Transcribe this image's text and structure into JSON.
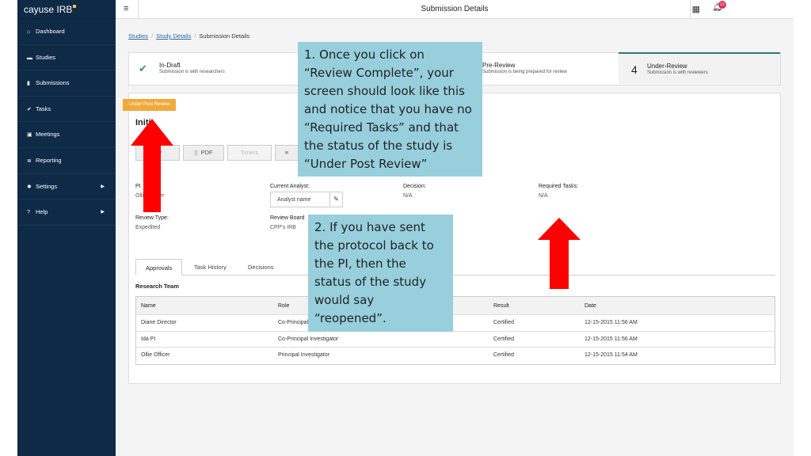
{
  "brand": {
    "name": "cayuse IRB",
    "accent": "#f0c040"
  },
  "sidebar": {
    "items": [
      {
        "label": "Dashboard",
        "icon": "home-icon"
      },
      {
        "label": "Studies",
        "icon": "folder-icon"
      },
      {
        "label": "Submissions",
        "icon": "document-icon"
      },
      {
        "label": "Tasks",
        "icon": "check-icon"
      },
      {
        "label": "Meetings",
        "icon": "calendar-icon"
      },
      {
        "label": "Reporting",
        "icon": "list-icon"
      },
      {
        "label": "Settings",
        "icon": "gear-icon"
      },
      {
        "label": "Help",
        "icon": "question-icon"
      }
    ]
  },
  "topbar": {
    "title": "Submission Details",
    "notification_count": "13"
  },
  "breadcrumb": {
    "items": [
      "Studies",
      "Study Details",
      "Submission Details"
    ]
  },
  "steps": {
    "step1": {
      "title": "In-Draft",
      "subtitle": "Submission is with researchers"
    },
    "step3": {
      "title": "Pre-Review",
      "subtitle": "Submission is being prepared for review"
    },
    "step4": {
      "number": "4",
      "title": "Under-Review",
      "subtitle": "Submission is with reviewers"
    }
  },
  "panel": {
    "status_ribbon": "Under Post Review",
    "submission_name": "Initi",
    "buttons": {
      "review": "ew",
      "pdf": "PDF",
      "timer": "Timers"
    },
    "fields": {
      "pi_label": "PI",
      "pi_value": "Ollie Officer",
      "analyst_label": "Current Analyst:",
      "analyst_value": "Analyst name",
      "decision_label": "Decision:",
      "decision_value": "N/A",
      "required_label": "Required Tasks:",
      "required_value": "N/A",
      "review_type_label": "Review Type:",
      "review_type_value": "Expedited",
      "board_label": "Review Board",
      "board_value": "CPP's IRB"
    },
    "tabs": [
      "Approvals",
      "Task History",
      "Decisions"
    ],
    "section_heading": "Research Team",
    "table": {
      "headers": [
        "Name",
        "Role",
        "Result",
        "Date"
      ],
      "rows": [
        [
          "Diane Director",
          "Co-Principal",
          "Certified",
          "12-15-2015 11:56 AM"
        ],
        [
          "Ida PI",
          "Co-Principal Investigator",
          "Certified",
          "12-15-2015 11:56 AM"
        ],
        [
          "Ollie Officer",
          "Principal Investigator",
          "Certified",
          "12-15-2015 11:54 AM"
        ]
      ]
    }
  },
  "callouts": {
    "first": "1. Once you click on\n“Review Complete”, your\nscreen should look like this\nand notice that you have no\n“Required Tasks” and that\nthe status of the study is\n“Under Post Review”",
    "second": "2. If you have sent\nthe protocol back to\nthe PI, then the\nstatus of the study\nwould say\n“reopened”."
  },
  "colors": {
    "sidebar": "#0e2a47",
    "ribbon": "#f0a93b",
    "callout": "#97cfdc",
    "arrow": "#ff0000"
  }
}
